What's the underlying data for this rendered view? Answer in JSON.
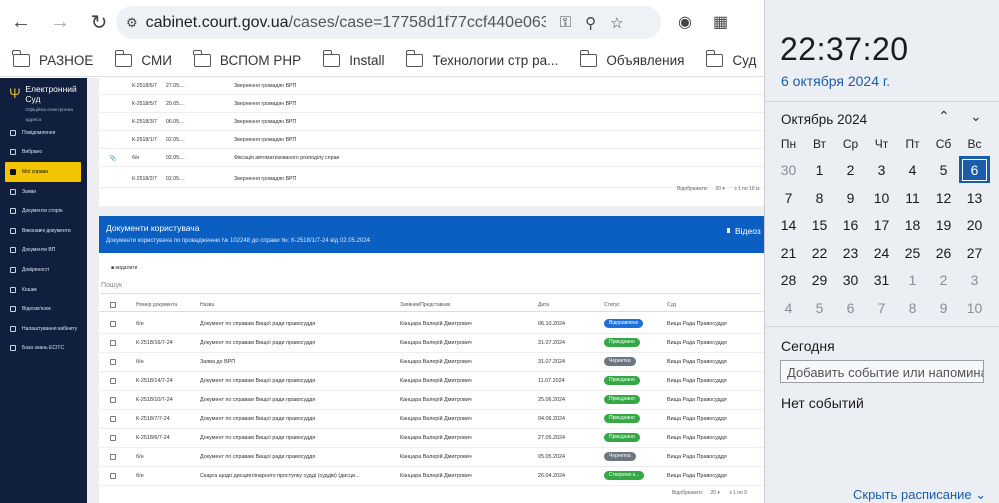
{
  "browser": {
    "url_domain": "cabinet.court.gov.ua",
    "url_path": "/cases/case=17758d1f77ccf440e06314060..."
  },
  "bookmarks": [
    "РАЗНОЕ",
    "СМИ",
    "ВСПОМ PHP",
    "Install",
    "Технологии стр ра...",
    "Объявления",
    "Суд"
  ],
  "sidebar": {
    "logo_title_1": "Електронний",
    "logo_title_2": "Суд",
    "logo_sub": "Офіційна електронна адреса",
    "items": [
      {
        "label": "Повідомлення"
      },
      {
        "label": "Вибрано"
      },
      {
        "label": "Мої справи"
      },
      {
        "label": "Заяви"
      },
      {
        "label": "Документи сторін"
      },
      {
        "label": "Виконавчі документи"
      },
      {
        "label": "Документи ВП"
      },
      {
        "label": "Довіреності"
      },
      {
        "label": "Кошик"
      },
      {
        "label": "Відеозв'язок"
      },
      {
        "label": "Налаштування кабінету"
      },
      {
        "label": "База знань ЕСІТС"
      }
    ]
  },
  "case_docs": {
    "rows": [
      {
        "num": "К-2518/6/7",
        "date": "27.05....",
        "desc": "Звернення громадян ВРП",
        "clip": ""
      },
      {
        "num": "К-2518/5/7",
        "date": "20.05....",
        "desc": "Звернення громадян ВРП",
        "clip": ""
      },
      {
        "num": "К-2518/3/7",
        "date": "06.05....",
        "desc": "Звернення громадян ВРП",
        "clip": ""
      },
      {
        "num": "К-2518/1/7",
        "date": "02.05....",
        "desc": "Звернення громадян ВРП",
        "clip": ""
      },
      {
        "num": "б/н",
        "date": "02.05....",
        "desc": "Фіксація автоматизованого розподілу справ",
        "clip": "📎"
      },
      {
        "num": "К-2518/2/7",
        "date": "02.05....",
        "desc": "Звернення громадян ВРП",
        "clip": ""
      }
    ],
    "pager_label": "Відображати:",
    "pager_count": "20",
    "pager_range": "з 1 по 16 із"
  },
  "user_docs": {
    "title": "Документи користувача",
    "subtitle": "Документи користувача по провадженню № 102248 до справи №: К-2518/1/7-24 від 02.05.2024",
    "video_btn": "Відеоз",
    "delete_btn": "видалити",
    "search_placeholder": "Пошук",
    "headers": {
      "num": "Номер документа",
      "name": "Назва",
      "applicant": "Заявник/Представник",
      "date": "Дата",
      "status": "Статус",
      "court": "Суд"
    },
    "rows": [
      {
        "num": "б/н",
        "name": "Документ по справам Вищої ради правосуддя",
        "applicant": "Канцара Валерій Дмитрович",
        "date": "06.10.2024",
        "status": "Відправлено",
        "court": "Вища Рада Правосуддя"
      },
      {
        "num": "К-2518/16/7-24",
        "name": "Документ по справам Вищої ради правосуддя",
        "applicant": "Канцара Валерій Дмитрович",
        "date": "31.07.2024",
        "status": "Приєднано",
        "court": "Вища Рада Правосуддя"
      },
      {
        "num": "б/н",
        "name": "Заява до ВРП",
        "applicant": "Канцара Валерій Дмитрович",
        "date": "31.07.2024",
        "status": "Чернетка",
        "court": "Вища Рада Правосуддя"
      },
      {
        "num": "К-2518/14/7-24",
        "name": "Документ по справам Вищої ради правосуддя",
        "applicant": "Канцара Валерій Дмитрович",
        "date": "11.07.2024",
        "status": "Приєднано",
        "court": "Вища Рада Правосуддя"
      },
      {
        "num": "К-2518/10/7-24",
        "name": "Документ по справам Вищої ради правосуддя",
        "applicant": "Канцара Валерій Дмитрович",
        "date": "25.06.2024",
        "status": "Приєднано",
        "court": "Вища Рада Правосуддя"
      },
      {
        "num": "К-2518/7/7-24",
        "name": "Документ по справам Вищої ради правосуддя",
        "applicant": "Канцара Валерій Дмитрович",
        "date": "04.06.2024",
        "status": "Приєднано",
        "court": "Вища Рада Правосуддя"
      },
      {
        "num": "К-2518/6/7-24",
        "name": "Документ по справам Вищої ради правосуддя",
        "applicant": "Канцара Валерій Дмитрович",
        "date": "27.05.2024",
        "status": "Приєднано",
        "court": "Вища Рада Правосуддя"
      },
      {
        "num": "б/н",
        "name": "Документ по справам Вищої ради правосуддя",
        "applicant": "Канцара Валерій Дмитрович",
        "date": "05.05.2024",
        "status": "Чернетка",
        "court": "Вища Рада Правосуддя"
      },
      {
        "num": "б/н",
        "name": "Скарга щодо дисциплінарного проступку судді (суддів) (дисци...",
        "applicant": "Канцара Валерій Дмитрович",
        "date": "26.04.2024",
        "status": "Створено к...",
        "court": "Вища Рада Правосуддя"
      }
    ],
    "pager_label": "Відображати:",
    "pager_count": "20",
    "pager_range": "з 1 по 9"
  },
  "status_colors": {
    "Відправлено": "#1e6fd9",
    "Приєднано": "#35a845",
    "Чернетка": "#6c7680",
    "Створено к...": "#35a845"
  },
  "calendar": {
    "time": "22:37:20",
    "date": "6 октября 2024 г.",
    "month": "Октябрь 2024",
    "weekdays": [
      "Пн",
      "Вт",
      "Ср",
      "Чт",
      "Пт",
      "Сб",
      "Вс"
    ],
    "days": [
      "30",
      "1",
      "2",
      "3",
      "4",
      "5",
      "6",
      "7",
      "8",
      "9",
      "10",
      "11",
      "12",
      "13",
      "14",
      "15",
      "16",
      "17",
      "18",
      "19",
      "20",
      "21",
      "22",
      "23",
      "24",
      "25",
      "26",
      "27",
      "28",
      "29",
      "30",
      "31",
      "1",
      "2",
      "3",
      "4",
      "5",
      "6",
      "7",
      "8",
      "9",
      "10"
    ],
    "today_index": 6,
    "other_month": [
      0,
      32,
      33,
      34,
      35,
      36,
      37,
      38,
      39,
      40,
      41
    ],
    "today_label": "Сегодня",
    "event_placeholder": "Добавить событие или напоминание",
    "no_events": "Нет событий",
    "hide_label": "Скрыть расписание"
  }
}
